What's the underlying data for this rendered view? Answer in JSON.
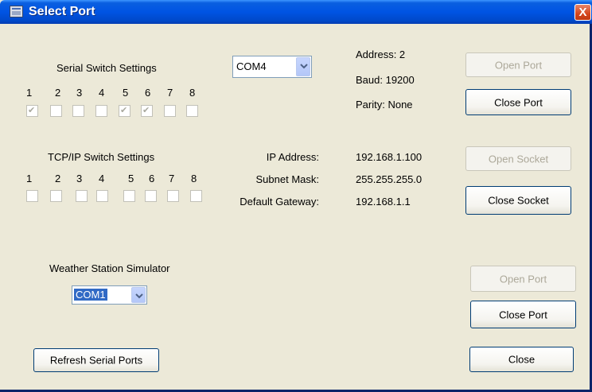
{
  "window": {
    "title": "Select Port",
    "close_glyph": "X"
  },
  "serial": {
    "heading": "Serial Switch Settings",
    "labels": [
      "1",
      "2",
      "3",
      "4",
      "5",
      "6",
      "7",
      "8"
    ],
    "checked": [
      true,
      false,
      false,
      false,
      true,
      true,
      false,
      false
    ],
    "com_port": "COM4",
    "address": "Address: 2",
    "baud": "Baud: 19200",
    "parity": "Parity: None",
    "open_button": "Open Port",
    "close_button": "Close Port"
  },
  "tcp": {
    "heading": "TCP/IP Switch Settings",
    "labels": [
      "1",
      "2",
      "3",
      "4",
      "5",
      "6",
      "7",
      "8"
    ],
    "checked": [
      false,
      false,
      false,
      false,
      false,
      false,
      false,
      false
    ],
    "ip_label": "IP Address:",
    "ip_value": "192.168.1.100",
    "subnet_label": "Subnet Mask:",
    "subnet_value": "255.255.255.0",
    "gateway_label": "Default Gateway:",
    "gateway_value": "192.168.1.1",
    "open_button": "Open Socket",
    "close_button": "Close Socket"
  },
  "weather": {
    "heading": "Weather Station Simulator",
    "com_port": "COM1",
    "open_button": "Open Port",
    "close_button": "Close Port"
  },
  "footer": {
    "refresh_button": "Refresh Serial Ports",
    "close_button": "Close"
  }
}
